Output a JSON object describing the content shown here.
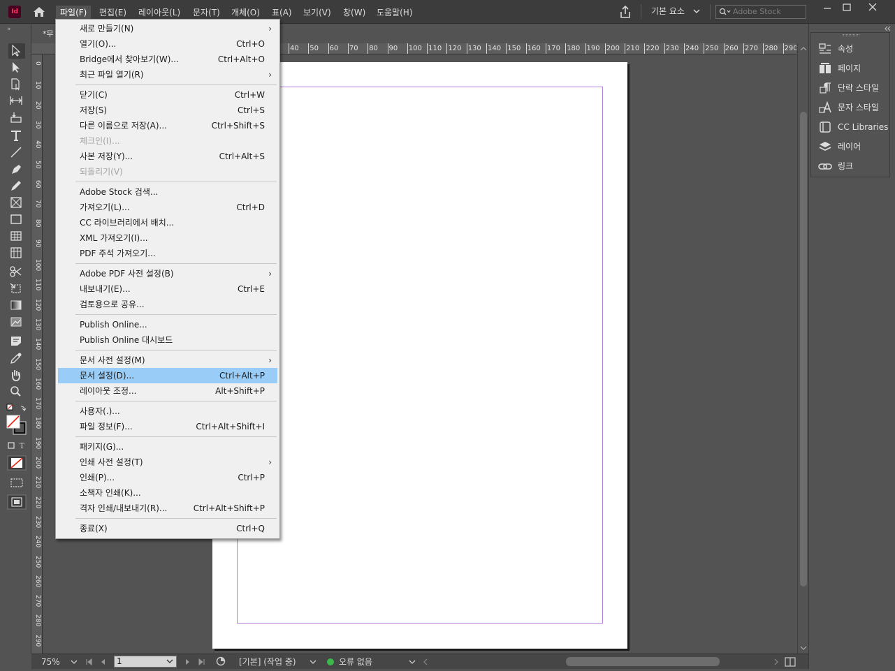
{
  "app": {
    "logo_text": "Id"
  },
  "menubar": {
    "items": [
      "파일(F)",
      "편집(E)",
      "레이아웃(L)",
      "문자(T)",
      "개체(O)",
      "표(A)",
      "보기(V)",
      "창(W)",
      "도움말(H)"
    ],
    "active_index": 0,
    "workspace": "기본 요소",
    "stock_placeholder": "Adobe Stock"
  },
  "document": {
    "tab_label": "*무",
    "zoom": "75%",
    "page": "1",
    "preflight_profile": "[기본] (작업 중)",
    "error_status": "오류 없음",
    "status_color": "#3db84a"
  },
  "ruler": {
    "h_labels": [
      "40",
      "50",
      "60",
      "70",
      "80",
      "90",
      "100",
      "110",
      "120",
      "130",
      "140",
      "150",
      "160",
      "170",
      "180",
      "190",
      "200",
      "210",
      "220",
      "230",
      "240",
      "250",
      "260",
      "270",
      "280",
      "290"
    ],
    "v_labels": [
      "0",
      "10",
      "20",
      "30",
      "40",
      "50",
      "60",
      "70",
      "80",
      "90",
      "100",
      "110",
      "120",
      "130",
      "140",
      "150",
      "160",
      "170",
      "180",
      "190",
      "200",
      "210",
      "220",
      "230",
      "240",
      "250",
      "260",
      "270",
      "280",
      "290"
    ]
  },
  "file_menu": {
    "groups": [
      [
        {
          "label": "새로 만들기(N)",
          "shortcut": "",
          "submenu": true
        },
        {
          "label": "열기(O)...",
          "shortcut": "Ctrl+O"
        },
        {
          "label": "Bridge에서 찾아보기(W)...",
          "shortcut": "Ctrl+Alt+O"
        },
        {
          "label": "최근 파일 열기(R)",
          "shortcut": "",
          "submenu": true
        }
      ],
      [
        {
          "label": "닫기(C)",
          "shortcut": "Ctrl+W"
        },
        {
          "label": "저장(S)",
          "shortcut": "Ctrl+S"
        },
        {
          "label": "다른 이름으로 저장(A)...",
          "shortcut": "Ctrl+Shift+S"
        },
        {
          "label": "체크인(I)...",
          "shortcut": "",
          "disabled": true
        },
        {
          "label": "사본 저장(Y)...",
          "shortcut": "Ctrl+Alt+S"
        },
        {
          "label": "되돌리기(V)",
          "shortcut": "",
          "disabled": true
        }
      ],
      [
        {
          "label": "Adobe Stock 검색...",
          "shortcut": ""
        },
        {
          "label": "가져오기(L)...",
          "shortcut": "Ctrl+D"
        },
        {
          "label": "CC 라이브러리에서 배치...",
          "shortcut": ""
        },
        {
          "label": "XML 가져오기(I)...",
          "shortcut": ""
        },
        {
          "label": "PDF 주석 가져오기...",
          "shortcut": ""
        }
      ],
      [
        {
          "label": "Adobe PDF 사전 설정(B)",
          "shortcut": "",
          "submenu": true
        },
        {
          "label": "내보내기(E)...",
          "shortcut": "Ctrl+E"
        },
        {
          "label": "검토용으로 공유...",
          "shortcut": ""
        }
      ],
      [
        {
          "label": "Publish Online...",
          "shortcut": ""
        },
        {
          "label": "Publish Online 대시보드",
          "shortcut": ""
        }
      ],
      [
        {
          "label": "문서 사전 설정(M)",
          "shortcut": "",
          "submenu": true
        },
        {
          "label": "문서 설정(D)...",
          "shortcut": "Ctrl+Alt+P",
          "highlighted": true
        },
        {
          "label": "레이아웃 조정...",
          "shortcut": "Alt+Shift+P"
        }
      ],
      [
        {
          "label": "사용자(.)...",
          "shortcut": ""
        },
        {
          "label": "파일 정보(F)...",
          "shortcut": "Ctrl+Alt+Shift+I"
        }
      ],
      [
        {
          "label": "패키지(G)...",
          "shortcut": ""
        },
        {
          "label": "인쇄 사전 설정(T)",
          "shortcut": "",
          "submenu": true
        },
        {
          "label": "인쇄(P)...",
          "shortcut": "Ctrl+P"
        },
        {
          "label": "소책자 인쇄(K)...",
          "shortcut": ""
        },
        {
          "label": "격자 인쇄/내보내기(R)...",
          "shortcut": "Ctrl+Alt+Shift+P"
        }
      ],
      [
        {
          "label": "종료(X)",
          "shortcut": "Ctrl+Q"
        }
      ]
    ]
  },
  "right_panels": [
    {
      "label": "속성",
      "icon": "properties-icon"
    },
    {
      "label": "페이지",
      "icon": "pages-icon"
    },
    {
      "label": "단락 스타일",
      "icon": "paragraph-style-icon"
    },
    {
      "label": "문자 스타일",
      "icon": "character-style-icon"
    },
    {
      "label": "CC Libraries",
      "icon": "cc-libraries-icon"
    },
    {
      "label": "레이어",
      "icon": "layers-icon"
    },
    {
      "label": "링크",
      "icon": "links-icon"
    }
  ],
  "tools": [
    "selection-tool-icon",
    "direct-selection-tool-icon",
    "page-tool-icon",
    "gap-tool-icon",
    "content-collector-icon",
    "type-tool-icon",
    "line-tool-icon",
    "pen-tool-icon",
    "pencil-tool-icon",
    "rectangle-frame-tool-icon",
    "rectangle-tool-icon",
    "table-tool-icon",
    "grid-tool-icon",
    "scissors-tool-icon",
    "free-transform-tool-icon",
    "gradient-swatch-tool-icon",
    "gradient-feather-tool-icon",
    "note-tool-icon",
    "eyedropper-tool-icon",
    "hand-tool-icon",
    "zoom-tool-icon"
  ]
}
